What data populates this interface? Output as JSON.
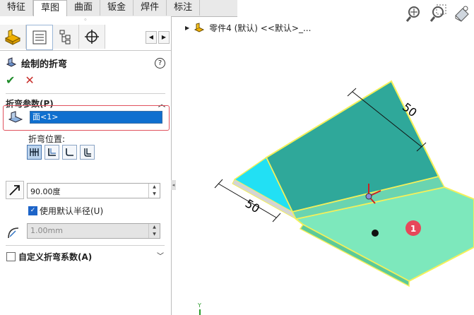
{
  "tabs": [
    "特征",
    "草图",
    "曲面",
    "钣金",
    "焊件",
    "标注"
  ],
  "active_tab": 1,
  "panel": {
    "grip": "◦",
    "feature_title": "绘制的折弯",
    "help": "?",
    "ok": "✔",
    "cancel": "✕",
    "group_params": "折弯参数(P)",
    "face_value": "面<1>",
    "bend_position_label": "折弯位置:",
    "angle_value": "90.00度",
    "use_default_radius": "使用默认半径(U)",
    "radius_value": "1.00mm",
    "custom_bend": "自定义折弯系数(A)"
  },
  "tree": {
    "part_label": "零件4 (默认) <<默认>_..."
  },
  "view": {
    "dim_top": "50",
    "dim_left": "50",
    "marker_label": "1",
    "axis_label": "Y"
  },
  "colors": {
    "accent_blue": "#0f6fcf",
    "highlight_red": "#e0525e",
    "sheet_green": "#7de8bc",
    "sheet_teal": "#2fa89a",
    "edge_yellow": "#f4f05a"
  }
}
